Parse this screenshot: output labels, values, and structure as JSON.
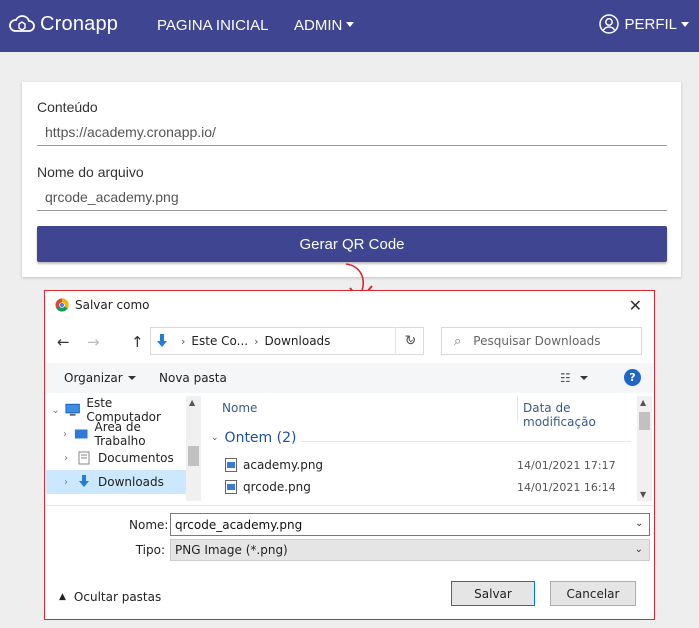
{
  "navbar": {
    "brand": "Cronapp",
    "home": "PAGINA INICIAL",
    "admin": "ADMIN",
    "profile": "PERFIL",
    "bg_color": "#3f4590"
  },
  "form": {
    "content_label": "Conteúdo",
    "content_value": "https://academy.cronapp.io/",
    "filename_label": "Nome do arquivo",
    "filename_value": "qrcode_academy.png",
    "generate_button": "Gerar QR Code"
  },
  "dialog": {
    "title": "Salvar como",
    "breadcrumb": [
      "Este Co...",
      "Downloads"
    ],
    "search_placeholder": "Pesquisar Downloads",
    "toolbar": {
      "organize": "Organizar",
      "new_folder": "Nova pasta"
    },
    "tree": [
      {
        "label": "Este Computador",
        "icon": "computer-icon"
      },
      {
        "label": "Área de Trabalho",
        "icon": "desktop-icon"
      },
      {
        "label": "Documentos",
        "icon": "document-icon"
      },
      {
        "label": "Downloads",
        "icon": "download-icon",
        "selected": true
      }
    ],
    "columns": {
      "name": "Nome",
      "date": "Data de modificação"
    },
    "group": "Ontem (2)",
    "files": [
      {
        "name": "academy.png",
        "date": "14/01/2021 17:17"
      },
      {
        "name": "qrcode.png",
        "date": "14/01/2021 16:14"
      }
    ],
    "name_label": "Nome:",
    "name_value": "qrcode_academy.png",
    "type_label": "Tipo:",
    "type_value": "PNG Image (*.png)",
    "hide_folders": "Ocultar pastas",
    "save": "Salvar",
    "cancel": "Cancelar",
    "highlight_color": "#d9282f"
  }
}
